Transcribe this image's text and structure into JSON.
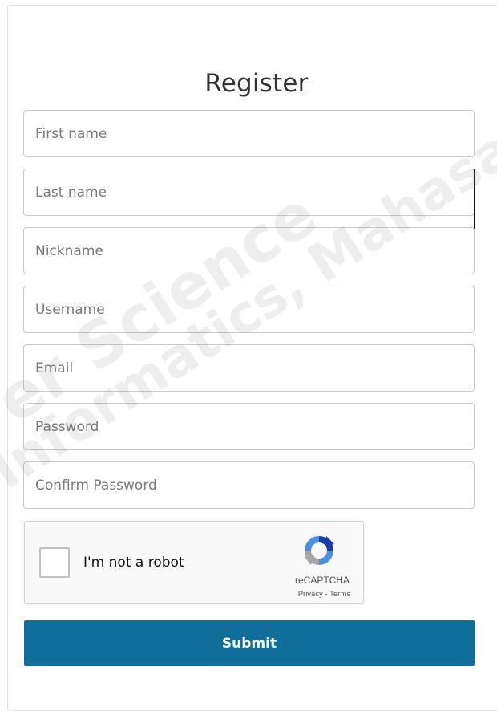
{
  "form": {
    "title": "Register",
    "fields": [
      {
        "placeholder": "First name"
      },
      {
        "placeholder": "Last name"
      },
      {
        "placeholder": "Nickname"
      },
      {
        "placeholder": "Username"
      },
      {
        "placeholder": "Email"
      },
      {
        "placeholder": "Password"
      },
      {
        "placeholder": "Confirm Password"
      }
    ],
    "submit_label": "Submit"
  },
  "captcha": {
    "checkbox_label": "I'm not a robot",
    "brand": "reCAPTCHA",
    "privacy": "Privacy",
    "separator": " - ",
    "terms": "Terms",
    "checked": false
  },
  "watermark": {
    "line1": "er Science ",
    "line2": "Informatics, Mahasarak"
  },
  "colors": {
    "submit_bg": "#0f6e9a",
    "field_border": "#c9c9c9",
    "captcha_bg": "#f9f9f9"
  }
}
